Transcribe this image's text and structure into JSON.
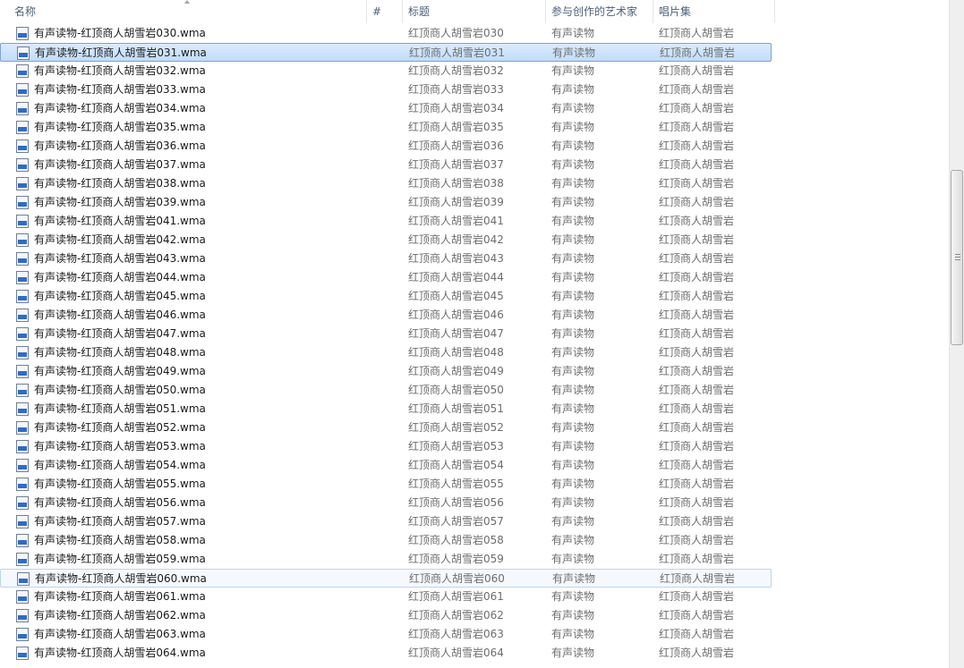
{
  "columns": {
    "name": "名称",
    "number": "#",
    "title": "标题",
    "artist": "参与创作的艺术家",
    "album": "唱片集"
  },
  "colors": {
    "selection": "#c1dcfc",
    "selection_border": "#7da2ce",
    "muted_text": "#6d6d6d"
  },
  "icons": {
    "file": "wma-audio-file-icon"
  },
  "rows": [
    {
      "name": "有声读物-红顶商人胡雪岩030.wma",
      "title": "红顶商人胡雪岩030",
      "artist": "有声读物",
      "album": "红顶商人胡雪岩",
      "state": ""
    },
    {
      "name": "有声读物-红顶商人胡雪岩031.wma",
      "title": "红顶商人胡雪岩031",
      "artist": "有声读物",
      "album": "红顶商人胡雪岩",
      "state": "selected"
    },
    {
      "name": "有声读物-红顶商人胡雪岩032.wma",
      "title": "红顶商人胡雪岩032",
      "artist": "有声读物",
      "album": "红顶商人胡雪岩",
      "state": ""
    },
    {
      "name": "有声读物-红顶商人胡雪岩033.wma",
      "title": "红顶商人胡雪岩033",
      "artist": "有声读物",
      "album": "红顶商人胡雪岩",
      "state": ""
    },
    {
      "name": "有声读物-红顶商人胡雪岩034.wma",
      "title": "红顶商人胡雪岩034",
      "artist": "有声读物",
      "album": "红顶商人胡雪岩",
      "state": ""
    },
    {
      "name": "有声读物-红顶商人胡雪岩035.wma",
      "title": "红顶商人胡雪岩035",
      "artist": "有声读物",
      "album": "红顶商人胡雪岩",
      "state": ""
    },
    {
      "name": "有声读物-红顶商人胡雪岩036.wma",
      "title": "红顶商人胡雪岩036",
      "artist": "有声读物",
      "album": "红顶商人胡雪岩",
      "state": ""
    },
    {
      "name": "有声读物-红顶商人胡雪岩037.wma",
      "title": "红顶商人胡雪岩037",
      "artist": "有声读物",
      "album": "红顶商人胡雪岩",
      "state": ""
    },
    {
      "name": "有声读物-红顶商人胡雪岩038.wma",
      "title": "红顶商人胡雪岩038",
      "artist": "有声读物",
      "album": "红顶商人胡雪岩",
      "state": ""
    },
    {
      "name": "有声读物-红顶商人胡雪岩039.wma",
      "title": "红顶商人胡雪岩039",
      "artist": "有声读物",
      "album": "红顶商人胡雪岩",
      "state": ""
    },
    {
      "name": "有声读物-红顶商人胡雪岩041.wma",
      "title": "红顶商人胡雪岩041",
      "artist": "有声读物",
      "album": "红顶商人胡雪岩",
      "state": ""
    },
    {
      "name": "有声读物-红顶商人胡雪岩042.wma",
      "title": "红顶商人胡雪岩042",
      "artist": "有声读物",
      "album": "红顶商人胡雪岩",
      "state": ""
    },
    {
      "name": "有声读物-红顶商人胡雪岩043.wma",
      "title": "红顶商人胡雪岩043",
      "artist": "有声读物",
      "album": "红顶商人胡雪岩",
      "state": ""
    },
    {
      "name": "有声读物-红顶商人胡雪岩044.wma",
      "title": "红顶商人胡雪岩044",
      "artist": "有声读物",
      "album": "红顶商人胡雪岩",
      "state": ""
    },
    {
      "name": "有声读物-红顶商人胡雪岩045.wma",
      "title": "红顶商人胡雪岩045",
      "artist": "有声读物",
      "album": "红顶商人胡雪岩",
      "state": ""
    },
    {
      "name": "有声读物-红顶商人胡雪岩046.wma",
      "title": "红顶商人胡雪岩046",
      "artist": "有声读物",
      "album": "红顶商人胡雪岩",
      "state": ""
    },
    {
      "name": "有声读物-红顶商人胡雪岩047.wma",
      "title": "红顶商人胡雪岩047",
      "artist": "有声读物",
      "album": "红顶商人胡雪岩",
      "state": ""
    },
    {
      "name": "有声读物-红顶商人胡雪岩048.wma",
      "title": "红顶商人胡雪岩048",
      "artist": "有声读物",
      "album": "红顶商人胡雪岩",
      "state": ""
    },
    {
      "name": "有声读物-红顶商人胡雪岩049.wma",
      "title": "红顶商人胡雪岩049",
      "artist": "有声读物",
      "album": "红顶商人胡雪岩",
      "state": ""
    },
    {
      "name": "有声读物-红顶商人胡雪岩050.wma",
      "title": "红顶商人胡雪岩050",
      "artist": "有声读物",
      "album": "红顶商人胡雪岩",
      "state": ""
    },
    {
      "name": "有声读物-红顶商人胡雪岩051.wma",
      "title": "红顶商人胡雪岩051",
      "artist": "有声读物",
      "album": "红顶商人胡雪岩",
      "state": ""
    },
    {
      "name": "有声读物-红顶商人胡雪岩052.wma",
      "title": "红顶商人胡雪岩052",
      "artist": "有声读物",
      "album": "红顶商人胡雪岩",
      "state": ""
    },
    {
      "name": "有声读物-红顶商人胡雪岩053.wma",
      "title": "红顶商人胡雪岩053",
      "artist": "有声读物",
      "album": "红顶商人胡雪岩",
      "state": ""
    },
    {
      "name": "有声读物-红顶商人胡雪岩054.wma",
      "title": "红顶商人胡雪岩054",
      "artist": "有声读物",
      "album": "红顶商人胡雪岩",
      "state": ""
    },
    {
      "name": "有声读物-红顶商人胡雪岩055.wma",
      "title": "红顶商人胡雪岩055",
      "artist": "有声读物",
      "album": "红顶商人胡雪岩",
      "state": ""
    },
    {
      "name": "有声读物-红顶商人胡雪岩056.wma",
      "title": "红顶商人胡雪岩056",
      "artist": "有声读物",
      "album": "红顶商人胡雪岩",
      "state": ""
    },
    {
      "name": "有声读物-红顶商人胡雪岩057.wma",
      "title": "红顶商人胡雪岩057",
      "artist": "有声读物",
      "album": "红顶商人胡雪岩",
      "state": ""
    },
    {
      "name": "有声读物-红顶商人胡雪岩058.wma",
      "title": "红顶商人胡雪岩058",
      "artist": "有声读物",
      "album": "红顶商人胡雪岩",
      "state": ""
    },
    {
      "name": "有声读物-红顶商人胡雪岩059.wma",
      "title": "红顶商人胡雪岩059",
      "artist": "有声读物",
      "album": "红顶商人胡雪岩",
      "state": ""
    },
    {
      "name": "有声读物-红顶商人胡雪岩060.wma",
      "title": "红顶商人胡雪岩060",
      "artist": "有声读物",
      "album": "红顶商人胡雪岩",
      "state": "hot"
    },
    {
      "name": "有声读物-红顶商人胡雪岩061.wma",
      "title": "红顶商人胡雪岩061",
      "artist": "有声读物",
      "album": "红顶商人胡雪岩",
      "state": ""
    },
    {
      "name": "有声读物-红顶商人胡雪岩062.wma",
      "title": "红顶商人胡雪岩062",
      "artist": "有声读物",
      "album": "红顶商人胡雪岩",
      "state": ""
    },
    {
      "name": "有声读物-红顶商人胡雪岩063.wma",
      "title": "红顶商人胡雪岩063",
      "artist": "有声读物",
      "album": "红顶商人胡雪岩",
      "state": ""
    },
    {
      "name": "有声读物-红顶商人胡雪岩064.wma",
      "title": "红顶商人胡雪岩064",
      "artist": "有声读物",
      "album": "红顶商人胡雪岩",
      "state": ""
    }
  ]
}
